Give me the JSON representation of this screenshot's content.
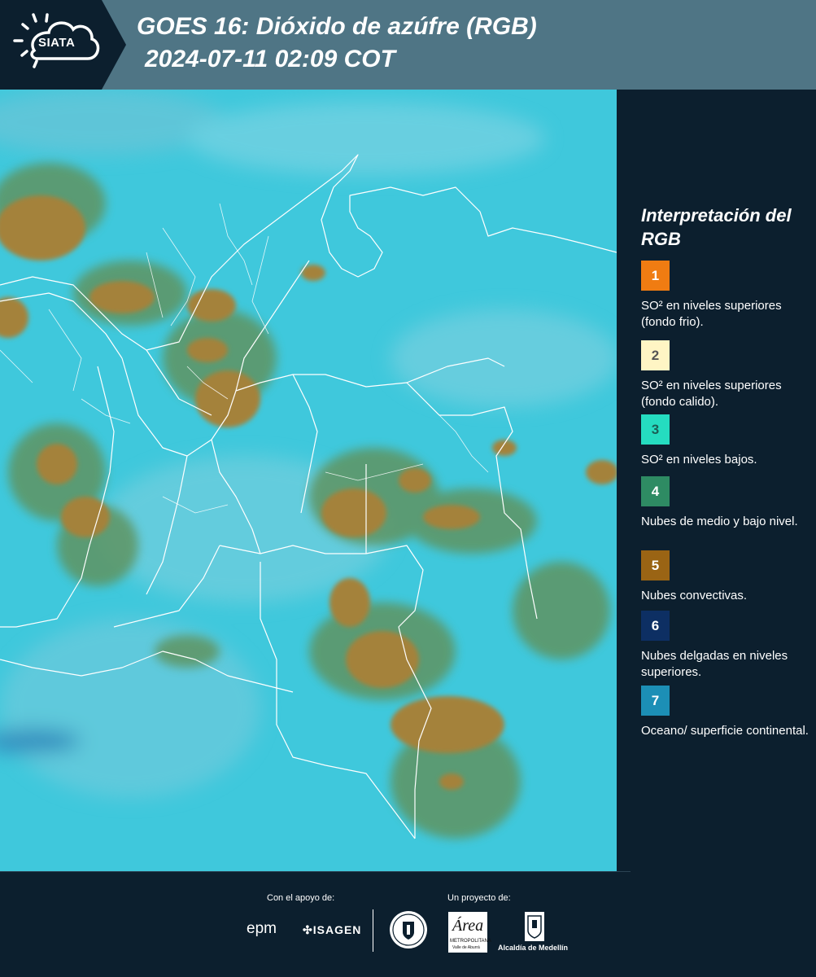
{
  "header": {
    "logo": "SIATA",
    "title": "GOES 16: Dióxido de azúfre (RGB)",
    "subtitle": "2024-07-11 02:09 COT"
  },
  "map": {
    "background_color": "#3fc8dc",
    "cloud_colors": {
      "convective": "#a4823a",
      "mid_low": "#5e9462",
      "thin": "#5595c0"
    }
  },
  "legend": {
    "title": "Interpretación del RGB",
    "items": [
      {
        "number": "1",
        "color": "#f07c12",
        "text_color": "#ffffff",
        "label": "SO² en niveles superiores (fondo frio)."
      },
      {
        "number": "2",
        "color": "#fff5c4",
        "text_color": "#555555",
        "label": "SO² en niveles superiores (fondo calido)."
      },
      {
        "number": "3",
        "color": "#25dcc0",
        "text_color": "#1b5e55",
        "label": "SO² en niveles bajos."
      },
      {
        "number": "4",
        "color": "#2e8b63",
        "text_color": "#ffffff",
        "label": "Nubes de medio y bajo nivel."
      },
      {
        "number": "5",
        "color": "#9a6414",
        "text_color": "#ffffff",
        "label": "Nubes convectivas."
      },
      {
        "number": "6",
        "color": "#0d2f63",
        "text_color": "#ffffff",
        "label": "Nubes delgadas en niveles superiores."
      },
      {
        "number": "7",
        "color": "#1c8fb6",
        "text_color": "#ffffff",
        "label": "Oceano/ superficie continental."
      }
    ]
  },
  "footer": {
    "support_label": "Con el apoyo de:",
    "project_label": "Un proyecto de:",
    "sponsors": [
      "epm",
      "ISAGEN"
    ],
    "area_logo": {
      "word": "Área",
      "line1": "METROPOLITANA",
      "line2": "Valle de Aburrá"
    },
    "alcaldia": "Alcaldía de Medellín"
  }
}
